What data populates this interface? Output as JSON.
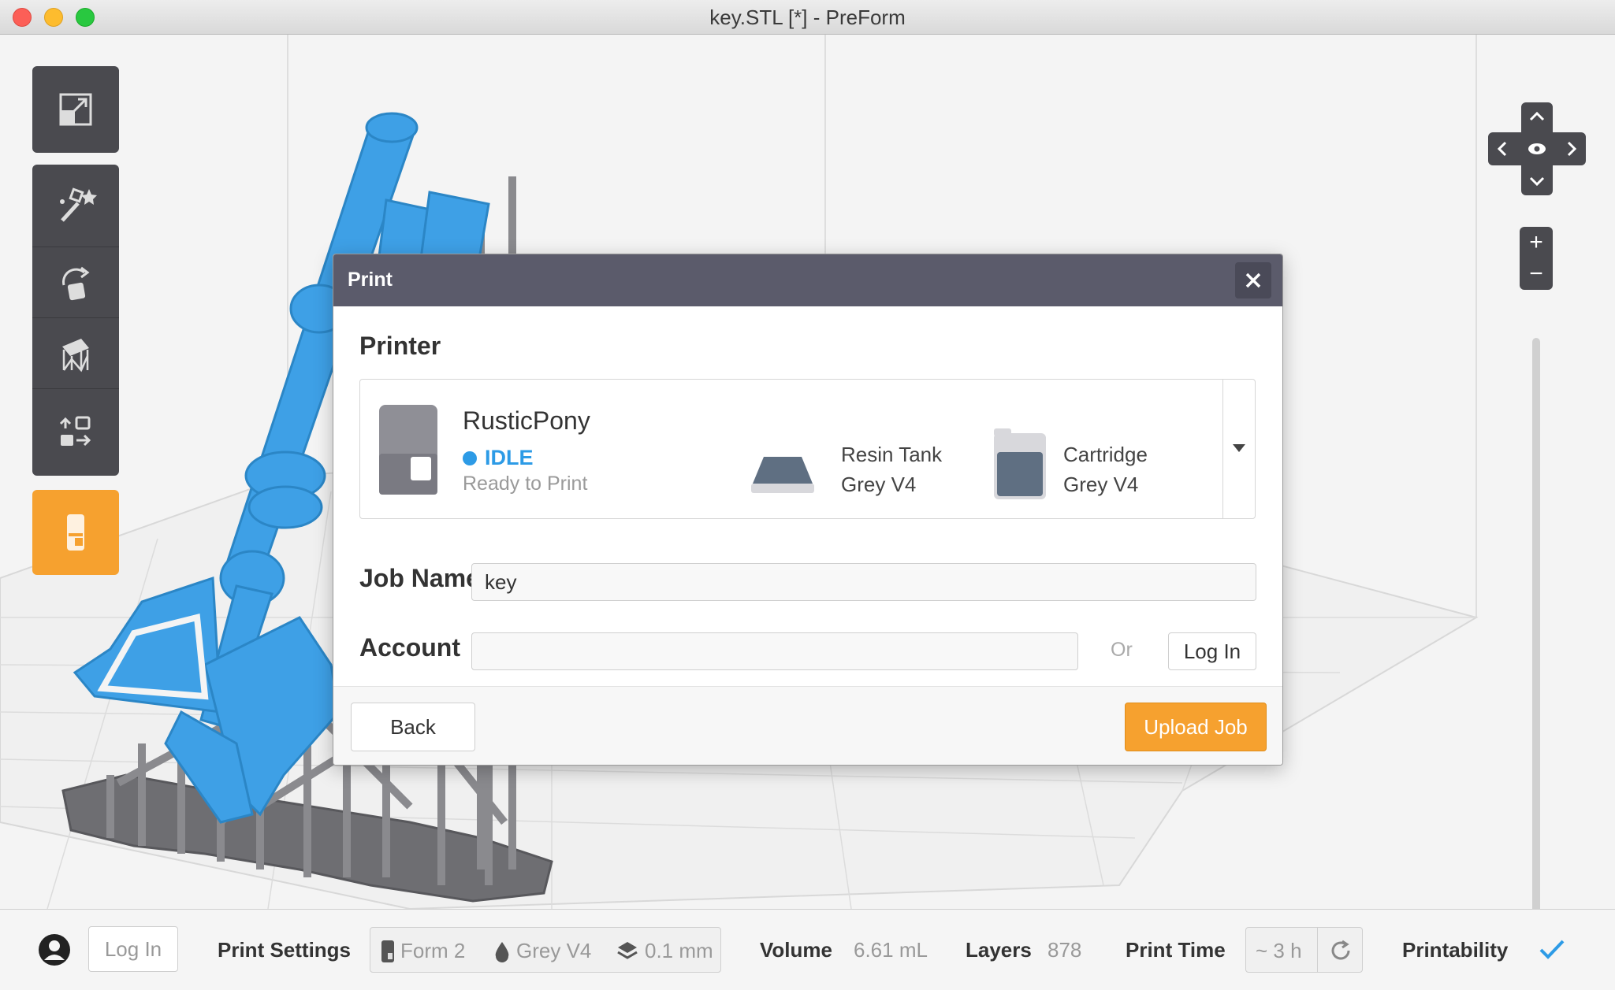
{
  "window": {
    "title": "key.STL [*] - PreForm"
  },
  "dialog": {
    "title": "Print",
    "printer_section_label": "Printer",
    "printer": {
      "name": "RusticPony",
      "status": "IDLE",
      "status_detail": "Ready to Print",
      "tank_label": "Resin Tank",
      "tank_value": "Grey V4",
      "cartridge_label": "Cartridge",
      "cartridge_value": "Grey V4"
    },
    "job_name_label": "Job Name",
    "job_name_value": "key",
    "account_label": "Account",
    "account_value": "",
    "or_label": "Or",
    "login_button": "Log In",
    "back_button": "Back",
    "upload_button": "Upload Job"
  },
  "statusbar": {
    "login_button": "Log In",
    "print_settings_label": "Print Settings",
    "printer_model": "Form 2",
    "material": "Grey V4",
    "layer_height": "0.1 mm",
    "volume_label": "Volume",
    "volume_value": "6.61 mL",
    "layers_label": "Layers",
    "layers_value": "878",
    "print_time_label": "Print Time",
    "print_time_value": "~ 3 h",
    "printability_label": "Printability"
  },
  "colors": {
    "accent": "#f6a12f",
    "model": "#3ea0e6",
    "status": "#2d9be6",
    "dialog_header": "#5b5b6b",
    "toolbar": "#4a4a4f"
  },
  "icons": [
    "window-close-icon",
    "window-minimize-icon",
    "window-maximize-icon",
    "scale-icon",
    "magic-wand-icon",
    "rotate-icon",
    "supports-icon",
    "layout-icon",
    "print-icon",
    "pan-up-icon",
    "pan-left-icon",
    "eye-icon",
    "pan-right-icon",
    "pan-down-icon",
    "zoom-in-icon",
    "zoom-out-icon",
    "close-icon",
    "printer-icon",
    "dropdown-arrow-icon",
    "resin-tank-icon",
    "cartridge-icon",
    "user-avatar-icon",
    "printer-small-icon",
    "resin-drop-icon",
    "layers-icon",
    "refresh-icon",
    "checkmark-icon"
  ]
}
